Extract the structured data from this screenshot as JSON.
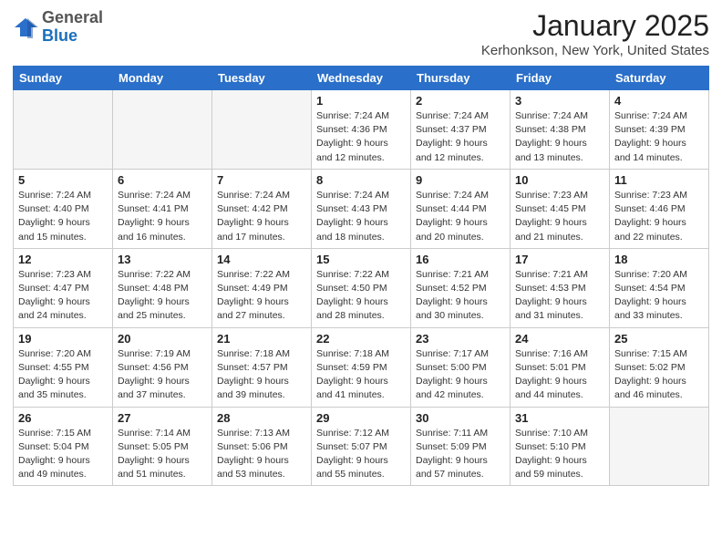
{
  "logo": {
    "general": "General",
    "blue": "Blue"
  },
  "header": {
    "title": "January 2025",
    "subtitle": "Kerhonkson, New York, United States"
  },
  "days_of_week": [
    "Sunday",
    "Monday",
    "Tuesday",
    "Wednesday",
    "Thursday",
    "Friday",
    "Saturday"
  ],
  "weeks": [
    [
      {
        "day": "",
        "info": ""
      },
      {
        "day": "",
        "info": ""
      },
      {
        "day": "",
        "info": ""
      },
      {
        "day": "1",
        "info": "Sunrise: 7:24 AM\nSunset: 4:36 PM\nDaylight: 9 hours\nand 12 minutes."
      },
      {
        "day": "2",
        "info": "Sunrise: 7:24 AM\nSunset: 4:37 PM\nDaylight: 9 hours\nand 12 minutes."
      },
      {
        "day": "3",
        "info": "Sunrise: 7:24 AM\nSunset: 4:38 PM\nDaylight: 9 hours\nand 13 minutes."
      },
      {
        "day": "4",
        "info": "Sunrise: 7:24 AM\nSunset: 4:39 PM\nDaylight: 9 hours\nand 14 minutes."
      }
    ],
    [
      {
        "day": "5",
        "info": "Sunrise: 7:24 AM\nSunset: 4:40 PM\nDaylight: 9 hours\nand 15 minutes."
      },
      {
        "day": "6",
        "info": "Sunrise: 7:24 AM\nSunset: 4:41 PM\nDaylight: 9 hours\nand 16 minutes."
      },
      {
        "day": "7",
        "info": "Sunrise: 7:24 AM\nSunset: 4:42 PM\nDaylight: 9 hours\nand 17 minutes."
      },
      {
        "day": "8",
        "info": "Sunrise: 7:24 AM\nSunset: 4:43 PM\nDaylight: 9 hours\nand 18 minutes."
      },
      {
        "day": "9",
        "info": "Sunrise: 7:24 AM\nSunset: 4:44 PM\nDaylight: 9 hours\nand 20 minutes."
      },
      {
        "day": "10",
        "info": "Sunrise: 7:23 AM\nSunset: 4:45 PM\nDaylight: 9 hours\nand 21 minutes."
      },
      {
        "day": "11",
        "info": "Sunrise: 7:23 AM\nSunset: 4:46 PM\nDaylight: 9 hours\nand 22 minutes."
      }
    ],
    [
      {
        "day": "12",
        "info": "Sunrise: 7:23 AM\nSunset: 4:47 PM\nDaylight: 9 hours\nand 24 minutes."
      },
      {
        "day": "13",
        "info": "Sunrise: 7:22 AM\nSunset: 4:48 PM\nDaylight: 9 hours\nand 25 minutes."
      },
      {
        "day": "14",
        "info": "Sunrise: 7:22 AM\nSunset: 4:49 PM\nDaylight: 9 hours\nand 27 minutes."
      },
      {
        "day": "15",
        "info": "Sunrise: 7:22 AM\nSunset: 4:50 PM\nDaylight: 9 hours\nand 28 minutes."
      },
      {
        "day": "16",
        "info": "Sunrise: 7:21 AM\nSunset: 4:52 PM\nDaylight: 9 hours\nand 30 minutes."
      },
      {
        "day": "17",
        "info": "Sunrise: 7:21 AM\nSunset: 4:53 PM\nDaylight: 9 hours\nand 31 minutes."
      },
      {
        "day": "18",
        "info": "Sunrise: 7:20 AM\nSunset: 4:54 PM\nDaylight: 9 hours\nand 33 minutes."
      }
    ],
    [
      {
        "day": "19",
        "info": "Sunrise: 7:20 AM\nSunset: 4:55 PM\nDaylight: 9 hours\nand 35 minutes."
      },
      {
        "day": "20",
        "info": "Sunrise: 7:19 AM\nSunset: 4:56 PM\nDaylight: 9 hours\nand 37 minutes."
      },
      {
        "day": "21",
        "info": "Sunrise: 7:18 AM\nSunset: 4:57 PM\nDaylight: 9 hours\nand 39 minutes."
      },
      {
        "day": "22",
        "info": "Sunrise: 7:18 AM\nSunset: 4:59 PM\nDaylight: 9 hours\nand 41 minutes."
      },
      {
        "day": "23",
        "info": "Sunrise: 7:17 AM\nSunset: 5:00 PM\nDaylight: 9 hours\nand 42 minutes."
      },
      {
        "day": "24",
        "info": "Sunrise: 7:16 AM\nSunset: 5:01 PM\nDaylight: 9 hours\nand 44 minutes."
      },
      {
        "day": "25",
        "info": "Sunrise: 7:15 AM\nSunset: 5:02 PM\nDaylight: 9 hours\nand 46 minutes."
      }
    ],
    [
      {
        "day": "26",
        "info": "Sunrise: 7:15 AM\nSunset: 5:04 PM\nDaylight: 9 hours\nand 49 minutes."
      },
      {
        "day": "27",
        "info": "Sunrise: 7:14 AM\nSunset: 5:05 PM\nDaylight: 9 hours\nand 51 minutes."
      },
      {
        "day": "28",
        "info": "Sunrise: 7:13 AM\nSunset: 5:06 PM\nDaylight: 9 hours\nand 53 minutes."
      },
      {
        "day": "29",
        "info": "Sunrise: 7:12 AM\nSunset: 5:07 PM\nDaylight: 9 hours\nand 55 minutes."
      },
      {
        "day": "30",
        "info": "Sunrise: 7:11 AM\nSunset: 5:09 PM\nDaylight: 9 hours\nand 57 minutes."
      },
      {
        "day": "31",
        "info": "Sunrise: 7:10 AM\nSunset: 5:10 PM\nDaylight: 9 hours\nand 59 minutes."
      },
      {
        "day": "",
        "info": ""
      }
    ]
  ]
}
